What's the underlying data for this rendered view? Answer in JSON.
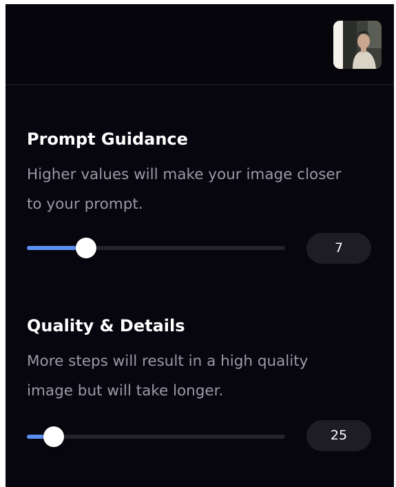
{
  "header": {
    "avatar_label": "user-avatar"
  },
  "prompt_guidance": {
    "title": "Prompt Guidance",
    "description": "Higher values will make your image closer to your prompt.",
    "value": "7",
    "fill_fraction": 0.23
  },
  "quality_details": {
    "title": "Quality & Details",
    "description": "More steps will result in a high quality image but will take longer.",
    "value": "25",
    "fill_fraction": 0.105
  },
  "colors": {
    "background": "#07050e",
    "accent": "#5a8ff0",
    "track": "#24222b",
    "pill": "#1e1c24",
    "muted_text": "#9c9aa6"
  }
}
